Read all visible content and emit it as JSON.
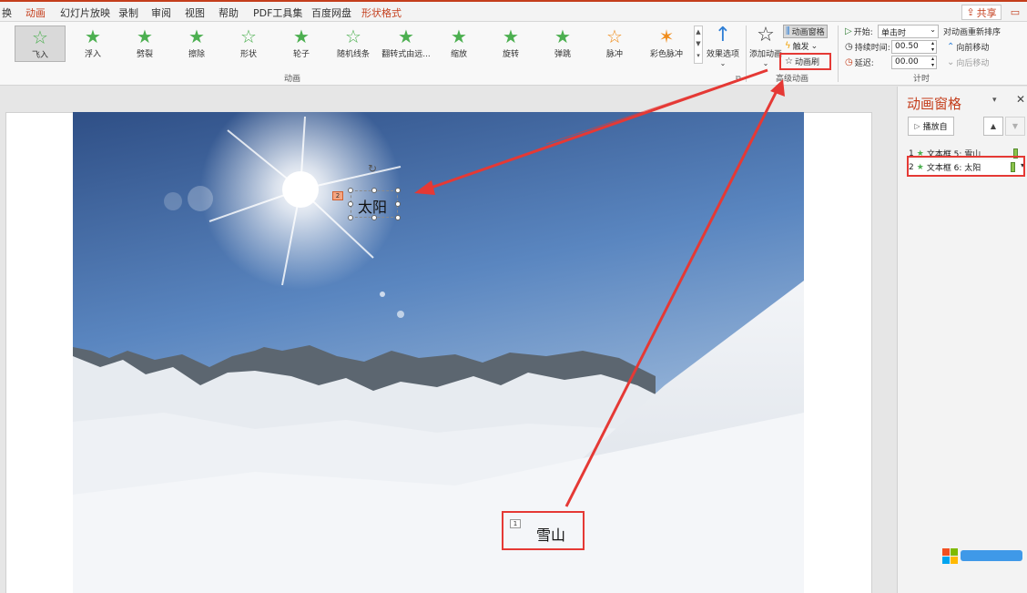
{
  "menu": {
    "tabs": [
      "换",
      "动画",
      "幻灯片放映",
      "录制",
      "审阅",
      "视图",
      "帮助",
      "PDF工具集",
      "百度网盘",
      "形状格式"
    ],
    "active_tab": "动画",
    "share_label": "共享"
  },
  "ribbon": {
    "effects": [
      {
        "label": "飞入",
        "icon": "fly-in-star-icon",
        "selected": true
      },
      {
        "label": "浮入",
        "icon": "float-in-star-icon"
      },
      {
        "label": "劈裂",
        "icon": "split-star-icon"
      },
      {
        "label": "擦除",
        "icon": "wipe-star-icon"
      },
      {
        "label": "形状",
        "icon": "shape-star-icon"
      },
      {
        "label": "轮子",
        "icon": "wheel-star-icon"
      },
      {
        "label": "随机线条",
        "icon": "random-bars-star-icon"
      },
      {
        "label": "翻转式由远...",
        "icon": "flip-star-icon"
      },
      {
        "label": "缩放",
        "icon": "zoom-star-icon"
      },
      {
        "label": "旋转",
        "icon": "spin-star-icon"
      },
      {
        "label": "弹跳",
        "icon": "bounce-star-icon"
      },
      {
        "label": "脉冲",
        "icon": "pulse-star-icon"
      },
      {
        "label": "彩色脉冲",
        "icon": "color-pulse-star-icon"
      }
    ],
    "effect_options_label": "效果选项",
    "animation_group_label": "动画",
    "add_animation_label": "添加动画",
    "animation_pane_label": "动画窗格",
    "trigger_label": "触发",
    "animation_painter_label": "动画刷",
    "advanced_group_label": "高级动画",
    "timing": {
      "start_label": "开始:",
      "start_value": "单击时",
      "duration_label": "持续时间:",
      "duration_value": "00.50",
      "delay_label": "延迟:",
      "delay_value": "00.00",
      "reorder_label": "对动画重新排序",
      "move_earlier_label": "向前移动",
      "move_later_label": "向后移动",
      "group_label": "计时"
    }
  },
  "slide": {
    "sun_text": "太阳",
    "sun_tag": "2",
    "mountain_text": "雪山",
    "mountain_tag": "1"
  },
  "pane": {
    "title": "动画窗格",
    "play_label": "播放自",
    "items": [
      {
        "index": "1",
        "name": "文本框 5: 雪山"
      },
      {
        "index": "2",
        "name": "文本框 6: 太阳",
        "selected": true
      }
    ]
  },
  "colors": {
    "accent": "#c43e1c",
    "highlight_red": "#e53935",
    "effect_green": "#4caf50"
  }
}
